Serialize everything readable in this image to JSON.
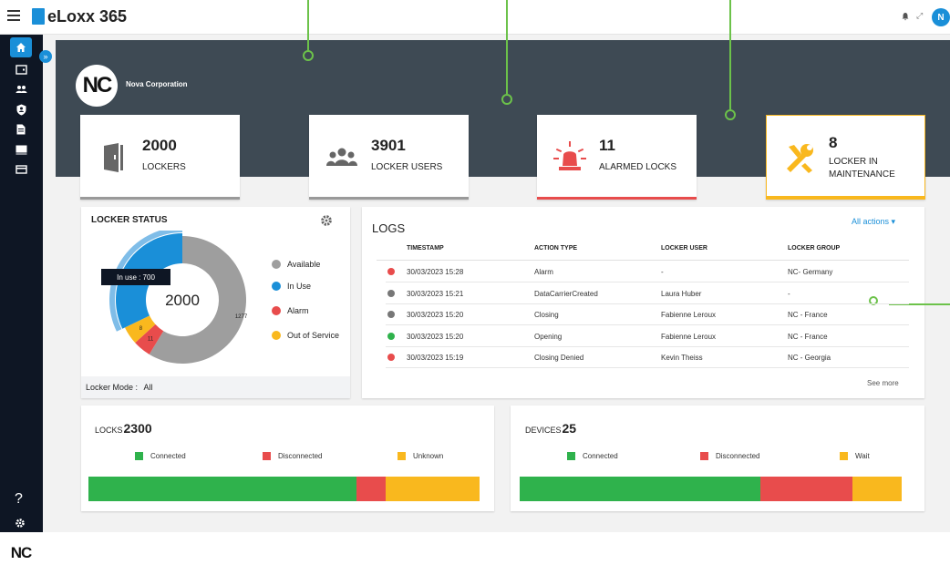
{
  "app": {
    "title": "eLoxx 365",
    "user_initial": "N"
  },
  "sidebar": {
    "nc_label": "NC"
  },
  "org": {
    "logo": "NC",
    "name": "Nova Corporation"
  },
  "stats": [
    {
      "value": "2000",
      "label": "LOCKERS",
      "icon": "locker-icon",
      "color": "#999999"
    },
    {
      "value": "3901",
      "label": "LOCKER USERS",
      "icon": "users-icon",
      "color": "#999999"
    },
    {
      "value": "11",
      "label": "ALARMED LOCKS",
      "icon": "alarm-icon",
      "color": "#e84c4c"
    },
    {
      "value": "8",
      "label_line1": "LOCKER IN",
      "label_line2": "MAINTENANCE",
      "icon": "tools-icon",
      "color": "#f9b81e"
    }
  ],
  "locker_status": {
    "title": "LOCKER STATUS",
    "total": "2000",
    "tooltip": "In use : 700",
    "segments": [
      {
        "name": "Available",
        "value": 1277,
        "label": "1277",
        "color": "#9e9e9e"
      },
      {
        "name": "In Use",
        "value": 700,
        "label": "700",
        "color": "#1a8fd8"
      },
      {
        "name": "Alarm",
        "value": 11,
        "label": "11",
        "color": "#e84c4c"
      },
      {
        "name": "Out of Service",
        "value": 8,
        "label": "8",
        "color": "#f9b81e"
      }
    ],
    "mode_label": "Locker Mode :",
    "mode_value": "All"
  },
  "logs": {
    "title": "LOGS",
    "filter": "All actions",
    "columns": [
      "TIMESTAMP",
      "ACTION TYPE",
      "LOCKER USER",
      "LOCKER GROUP"
    ],
    "rows": [
      {
        "status_color": "#e84c4c",
        "timestamp": "30/03/2023 15:28",
        "action": "Alarm",
        "user": "-",
        "group": "NC- Germany"
      },
      {
        "status_color": "#777777",
        "timestamp": "30/03/2023 15:21",
        "action": "DataCarrierCreated",
        "user": "Laura Huber",
        "group": "-"
      },
      {
        "status_color": "#777777",
        "timestamp": "30/03/2023 15:20",
        "action": "Closing",
        "user": "Fabienne Leroux",
        "group": "NC - France"
      },
      {
        "status_color": "#2fb24c",
        "timestamp": "30/03/2023 15:20",
        "action": "Opening",
        "user": "Fabienne Leroux",
        "group": "NC - France"
      },
      {
        "status_color": "#e84c4c",
        "timestamp": "30/03/2023 15:19",
        "action": "Closing Denied",
        "user": "Kevin Theiss",
        "group": "NC - Georgia"
      }
    ],
    "see_more": "See more"
  },
  "locks": {
    "title": "LOCKS",
    "count": "2300",
    "legend": [
      {
        "label": "Connected",
        "color": "#2fb24c"
      },
      {
        "label": "Disconnected",
        "color": "#e84c4c"
      },
      {
        "label": "Unknown",
        "color": "#f9b81e"
      }
    ],
    "segments": [
      {
        "value": 0.685,
        "color": "#2fb24c"
      },
      {
        "value": 0.075,
        "color": "#e84c4c"
      },
      {
        "value": 0.24,
        "color": "#f9b81e"
      }
    ]
  },
  "devices": {
    "title": "DEVICES",
    "count": "25",
    "legend": [
      {
        "label": "Connected",
        "color": "#2fb24c"
      },
      {
        "label": "Disconnected",
        "color": "#e84c4c"
      },
      {
        "label": "Wait",
        "color": "#f9b81e"
      }
    ],
    "segments": [
      {
        "value": 0.63,
        "color": "#2fb24c"
      },
      {
        "value": 0.24,
        "color": "#e84c4c"
      },
      {
        "value": 0.13,
        "color": "#f9b81e"
      }
    ]
  }
}
